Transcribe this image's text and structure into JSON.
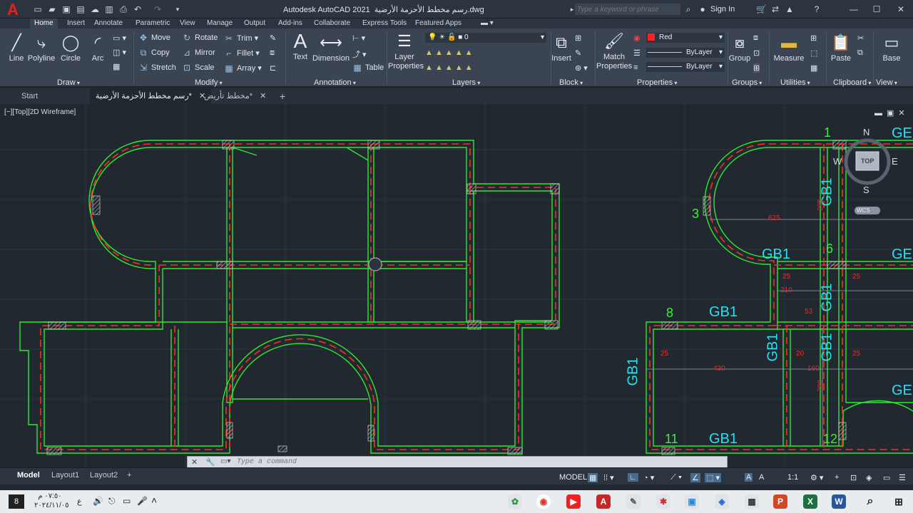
{
  "app": {
    "title": "Autodesk AutoCAD 2021",
    "file": "رسم مخطط الأحزمة الأرضية.dwg",
    "logo_letter": "A"
  },
  "search": {
    "placeholder": "Type a keyword or phrase"
  },
  "signin": "Sign In",
  "ribbon_tabs": [
    "Home",
    "Insert",
    "Annotate",
    "Parametric",
    "View",
    "Manage",
    "Output",
    "Add-ins",
    "Collaborate",
    "Express Tools",
    "Featured Apps"
  ],
  "draw": {
    "line": "Line",
    "polyline": "Polyline",
    "circle": "Circle",
    "arc": "Arc",
    "panel": "Draw"
  },
  "modify": {
    "move": "Move",
    "rotate": "Rotate",
    "trim": "Trim",
    "copy": "Copy",
    "mirror": "Mirror",
    "fillet": "Fillet",
    "stretch": "Stretch",
    "scale": "Scale",
    "array": "Array",
    "panel": "Modify"
  },
  "annotation": {
    "text": "Text",
    "dimension": "Dimension",
    "table": "Table",
    "panel": "Annotation"
  },
  "layers": {
    "layer_properties": "Layer Properties",
    "current_layer": "0",
    "panel": "Layers"
  },
  "block": {
    "insert": "Insert",
    "panel": "Block"
  },
  "properties": {
    "match": "Match Properties",
    "color": "Red",
    "linetype": "ByLayer",
    "lineweight": "ByLayer",
    "panel": "Properties"
  },
  "groups": {
    "group": "Group",
    "panel": "Groups"
  },
  "utilities": {
    "measure": "Measure",
    "panel": "Utilities"
  },
  "clipboard": {
    "paste": "Paste",
    "panel": "Clipboard"
  },
  "view_panel": {
    "base": "Base",
    "panel": "View"
  },
  "doc_tabs": [
    {
      "label": "Start"
    },
    {
      "label": "رسم مخطط الأحزمة الأرضية*"
    },
    {
      "label": "مخطط تأريض*"
    }
  ],
  "viewport_label": "[−][Top][2D Wireframe]",
  "viewcube": {
    "n": "N",
    "s": "S",
    "e": "E",
    "w": "W",
    "top": "TOP",
    "wcs": "WCS"
  },
  "drawing_labels": {
    "gb1": "GB1",
    "ge": "GE",
    "grid1": "1",
    "grid3": "3",
    "grid6": "6",
    "grid8": "8",
    "grid11": "11",
    "grid12": "12"
  },
  "dims": {
    "d625": "625",
    "d25": "25",
    "d210": "210",
    "d430": "430",
    "d20": "20",
    "d160": "160",
    "d390": "390",
    "d395": "395",
    "d53": "53"
  },
  "command": {
    "placeholder": "Type a command"
  },
  "layout_tabs": [
    "Model",
    "Layout1",
    "Layout2"
  ],
  "status": {
    "model": "MODEL",
    "scale": "1:1"
  },
  "taskbar": {
    "time": "٠٧:٥٠ م",
    "date": "٢٠٢٤/١١/٠٥",
    "lang": "ع",
    "notif": "8"
  },
  "colors": {
    "wall": "#2ee82e",
    "axis": "#ff2a2a",
    "label": "#27e0f0",
    "dim": "#e03030",
    "num": "#38f038",
    "ribbon": "#3a4452",
    "canvas": "#212830"
  }
}
